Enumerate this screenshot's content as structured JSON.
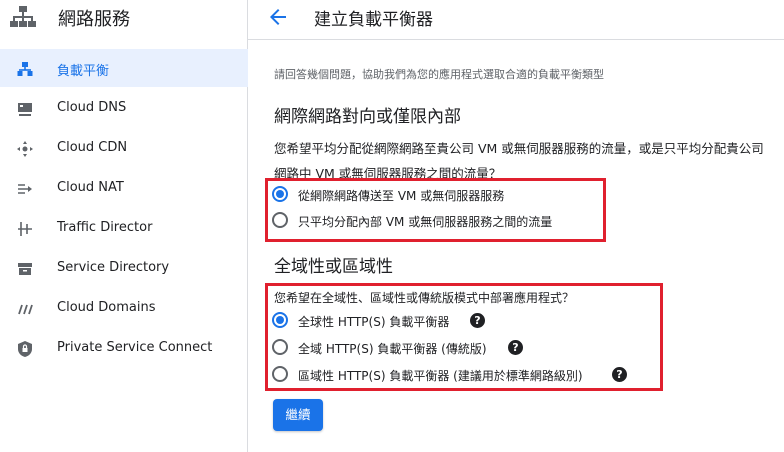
{
  "sidebar": {
    "title": "網路服務",
    "items": [
      {
        "label": "負載平衡",
        "icon": "load-balancing-icon"
      },
      {
        "label": "Cloud DNS",
        "icon": "dns-icon"
      },
      {
        "label": "Cloud CDN",
        "icon": "cdn-icon"
      },
      {
        "label": "Cloud NAT",
        "icon": "nat-icon"
      },
      {
        "label": "Traffic Director",
        "icon": "traffic-director-icon"
      },
      {
        "label": "Service Directory",
        "icon": "service-directory-icon"
      },
      {
        "label": "Cloud Domains",
        "icon": "domains-icon"
      },
      {
        "label": "Private Service Connect",
        "icon": "private-service-connect-icon"
      }
    ]
  },
  "header": {
    "title": "建立負載平衡器"
  },
  "main": {
    "intro": "請回答幾個問題，協助我們為您的應用程式選取合適的負載平衡類型",
    "section1": {
      "heading": "網際網路對向或僅限內部",
      "question_line1": "您希望平均分配從網際網路至貴公司 VM 或無伺服器服務的流量，或是只平均分配貴公司",
      "question_line2": "網路中 VM 或無伺服器服務之間的流量？",
      "options": [
        {
          "label": "從網際網路傳送至 VM 或無伺服器服務",
          "selected": true
        },
        {
          "label": "只平均分配內部 VM 或無伺服器服務之間的流量",
          "selected": false
        }
      ]
    },
    "section2": {
      "heading": "全域性或區域性",
      "question": "您希望在全域性、區域性或傳統版模式中部署應用程式？",
      "options": [
        {
          "label": "全球性 HTTP(S) 負載平衡器",
          "selected": true
        },
        {
          "label": "全域 HTTP(S) 負載平衡器 (傳統版)",
          "selected": false
        },
        {
          "label": "區域性 HTTP(S) 負載平衡器 (建議用於標準網路級別)",
          "selected": false
        }
      ],
      "help_glyph": "?"
    },
    "continue_label": "繼續"
  },
  "colors": {
    "accent": "#1a73e8",
    "highlight": "#e0202e",
    "active_bg": "#e8f0fe"
  }
}
